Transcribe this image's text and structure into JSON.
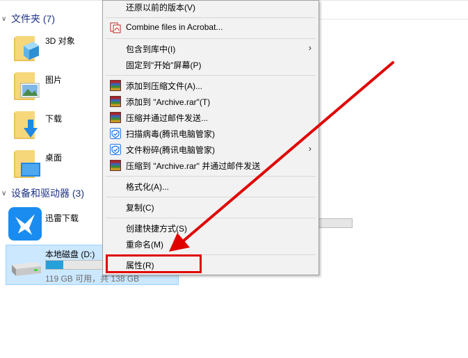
{
  "groups": {
    "folders_header": "文件夹 (7)",
    "devices_header": "设备和驱动器 (3)"
  },
  "folders": [
    {
      "label": "3D 对象",
      "icon": "folder-3d-icon"
    },
    {
      "label": "图片",
      "icon": "folder-pictures-icon"
    },
    {
      "label": "下载",
      "icon": "folder-downloads-icon"
    },
    {
      "label": "桌面",
      "icon": "folder-desktop-icon"
    }
  ],
  "devices": {
    "xunlei": {
      "label": "迅雷下载"
    },
    "drive_d": {
      "label": "本地磁盘 (D:)",
      "free_text": "119 GB 可用，共 138 GB",
      "used_fraction": 0.14
    },
    "other_bar": {
      "used_fraction": 0.0
    }
  },
  "menu": {
    "restore": "还原以前的版本(V)",
    "combine": "Combine files in Acrobat...",
    "include_library": "包含到库中(I)",
    "pin_start": "固定到\"开始\"屏幕(P)",
    "add_archive": "添加到压缩文件(A)...",
    "add_rar": "添加到 \"Archive.rar\"(T)",
    "compress_email": "压缩并通过邮件发送...",
    "scan_virus": "扫描病毒(腾讯电脑管家)",
    "shred": "文件粉碎(腾讯电脑管家)",
    "compress_rar_email": "压缩到 \"Archive.rar\" 并通过邮件发送",
    "format": "格式化(A)...",
    "copy": "复制(C)",
    "shortcut": "创建快捷方式(S)",
    "rename": "重命名(M)",
    "properties": "属性(R)"
  },
  "colors": {
    "annotation": "#e00000",
    "accent": "#26a0da",
    "selection": "#cce8ff"
  }
}
